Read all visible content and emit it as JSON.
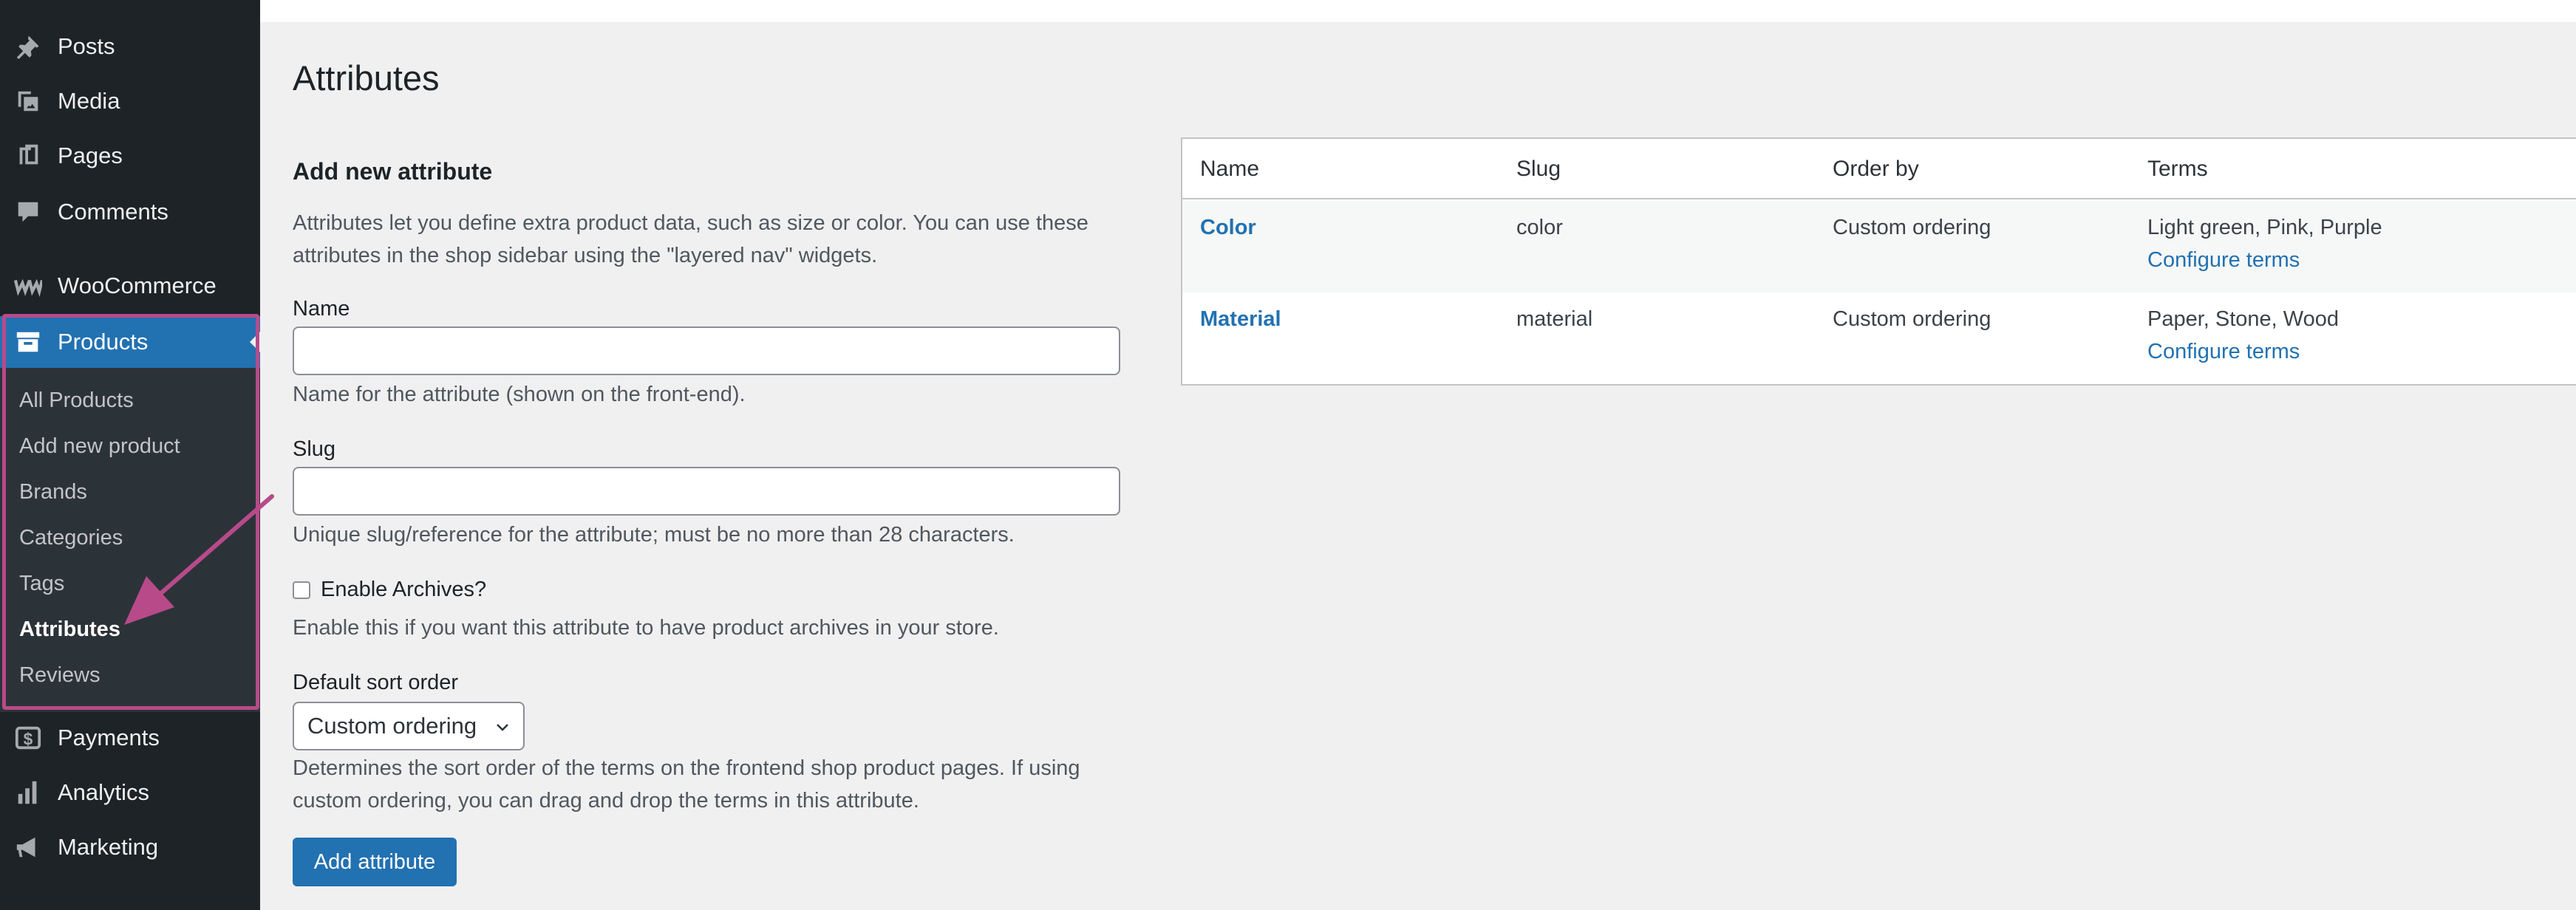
{
  "sidebar": {
    "menu": {
      "posts": "Posts",
      "media": "Media",
      "pages": "Pages",
      "comments": "Comments",
      "woocommerce": "WooCommerce",
      "products": "Products",
      "payments": "Payments",
      "analytics": "Analytics",
      "marketing": "Marketing"
    },
    "submenu": {
      "all_products": "All Products",
      "add_new": "Add new product",
      "brands": "Brands",
      "categories": "Categories",
      "tags": "Tags",
      "attributes": "Attributes",
      "reviews": "Reviews"
    },
    "highlight_color": "#b84a8a"
  },
  "page": {
    "title": "Attributes"
  },
  "form": {
    "heading": "Add new attribute",
    "description": "Attributes let you define extra product data, such as size or color. You can use these attributes in the shop sidebar using the \"layered nav\" widgets.",
    "name_label": "Name",
    "name_value": "",
    "name_help": "Name for the attribute (shown on the front-end).",
    "slug_label": "Slug",
    "slug_value": "",
    "slug_help": "Unique slug/reference for the attribute; must be no more than 28 characters.",
    "archives_label": "Enable Archives?",
    "archives_help": "Enable this if you want this attribute to have product archives in your store.",
    "sort_label": "Default sort order",
    "sort_value": "Custom ordering",
    "sort_help": "Determines the sort order of the terms on the frontend shop product pages. If using custom ordering, you can drag and drop the terms in this attribute.",
    "submit_label": "Add attribute"
  },
  "table": {
    "headers": {
      "name": "Name",
      "slug": "Slug",
      "order_by": "Order by",
      "terms": "Terms"
    },
    "rows": [
      {
        "name": "Color",
        "slug": "color",
        "order_by": "Custom ordering",
        "terms": "Light green, Pink, Purple",
        "configure": "Configure terms"
      },
      {
        "name": "Material",
        "slug": "material",
        "order_by": "Custom ordering",
        "terms": "Paper, Stone, Wood",
        "configure": "Configure terms"
      }
    ]
  },
  "colors": {
    "accent": "#2271b1",
    "sidebar_bg": "#1d2327",
    "submenu_bg": "#2c3338",
    "annotation": "#b84a8a"
  }
}
